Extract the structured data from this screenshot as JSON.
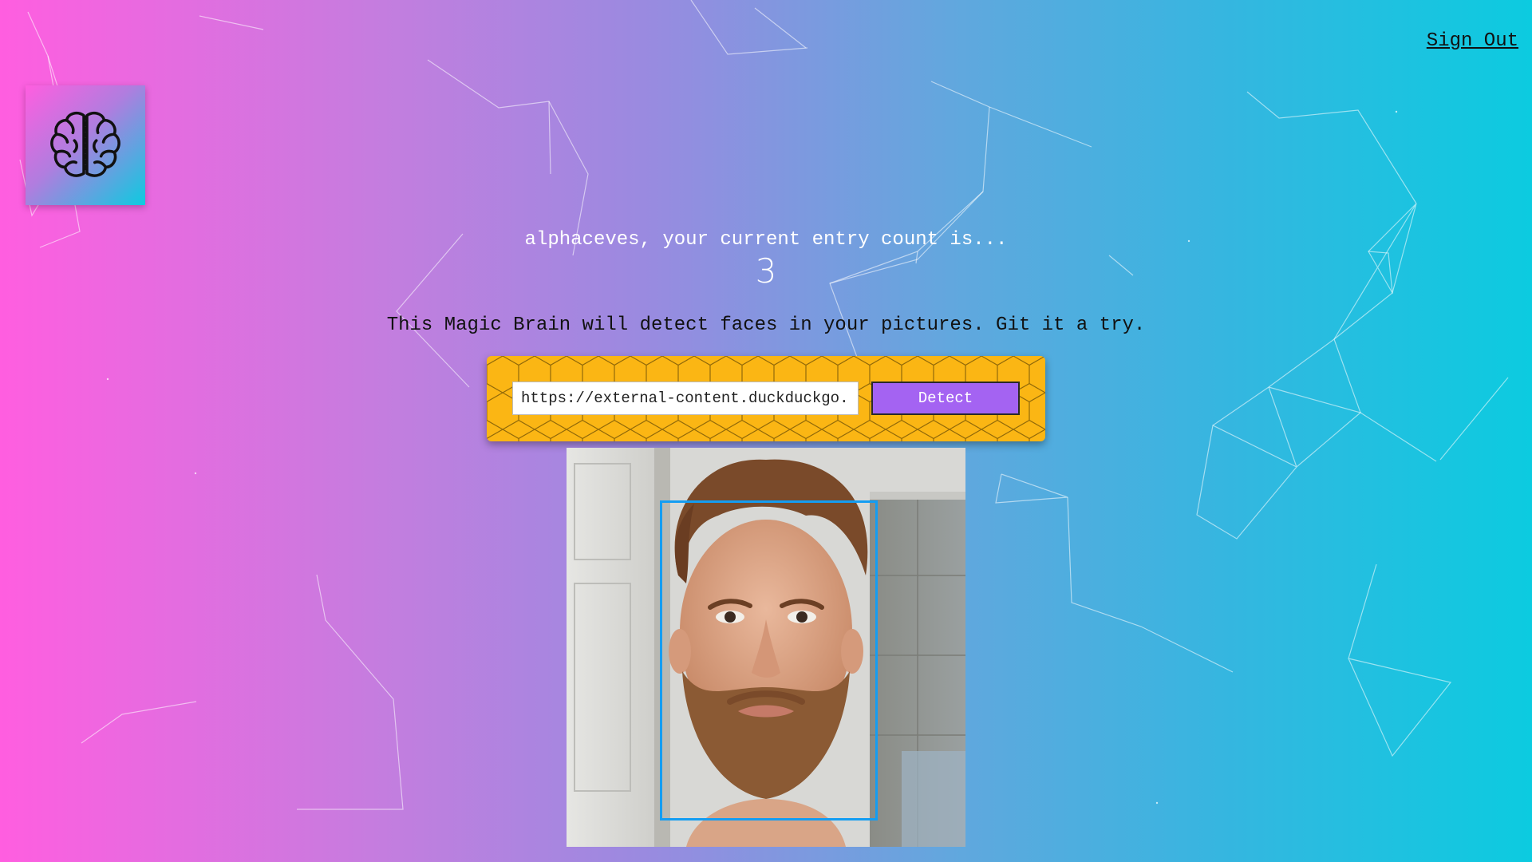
{
  "header": {
    "sign_out_label": "Sign Out"
  },
  "logo": {
    "icon": "brain-icon"
  },
  "rank": {
    "message": "alphaceves, your current entry count is...",
    "count": "3"
  },
  "description": "This Magic Brain will detect faces in your pictures. Git it a try.",
  "form": {
    "input_value": "https://external-content.duckduckgo.",
    "button_label": "Detect"
  },
  "face_recognition": {
    "image_description": "photo-of-bearded-man",
    "face_box_count": 1
  },
  "colors": {
    "gradient_left": "#ff5ee0",
    "gradient_right": "#0ccbe0",
    "panel_background": "#fbb614",
    "button_background": "#a463f2",
    "box_border": "#149df2"
  }
}
